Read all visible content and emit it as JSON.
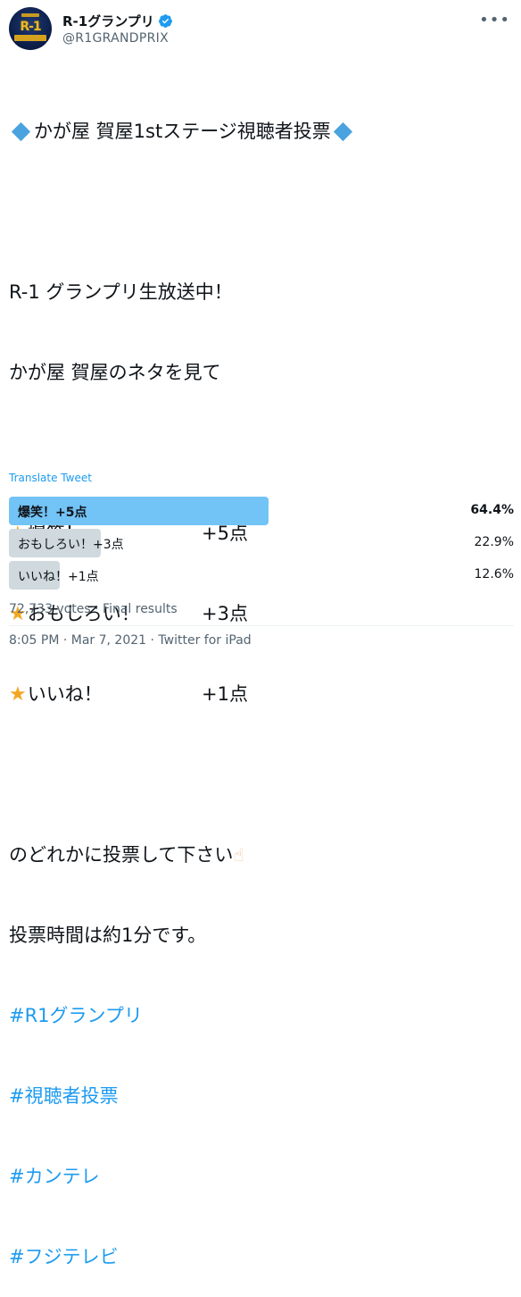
{
  "author": {
    "display_name": "R-1グランプリ",
    "handle": "@R1GRANDPRIX",
    "verified": true,
    "avatar_logo_text": "R-1"
  },
  "tweet": {
    "title_line": "かが屋 賀屋1stステージ視聴者投票",
    "line2": "R-1 グランプリ生放送中！",
    "line3": "かが屋 賀屋のネタを見て",
    "options": [
      {
        "label": "爆笑！",
        "points": "+5点"
      },
      {
        "label": "おもしろい！",
        "points": "+3点"
      },
      {
        "label": "いいね！",
        "points": "+1点"
      }
    ],
    "line_vote": "のどれかに投票して下さい",
    "line_time": "投票時間は約1分です。",
    "hashtags": [
      "#R1グランプリ",
      "#視聴者投票",
      "#カンテレ",
      "#フジテレビ"
    ]
  },
  "translate_label": "Translate Tweet",
  "poll": {
    "choices": [
      {
        "label": "爆笑！+5点",
        "percent_text": "64.4%",
        "percent": 64.4,
        "winner": true
      },
      {
        "label": "おもしろい！+3点",
        "percent_text": "22.9%",
        "percent": 22.9,
        "winner": false
      },
      {
        "label": "いいね！+1点",
        "percent_text": "12.6%",
        "percent": 12.6,
        "winner": false
      }
    ],
    "summary": "72,733 votes · Final results"
  },
  "meta": "8:05 PM · Mar 7, 2021 · Twitter for iPad",
  "colors": {
    "accent": "#1d9bf0",
    "winner_bar": "#72c3f6",
    "loser_bar": "#cfd9de",
    "star": "#f4a623",
    "diamond": "#4aa3df"
  },
  "icons": [
    "verified-badge-icon",
    "more-options-icon",
    "diamond-icon",
    "star-icon",
    "pointing-hand-icon"
  ]
}
